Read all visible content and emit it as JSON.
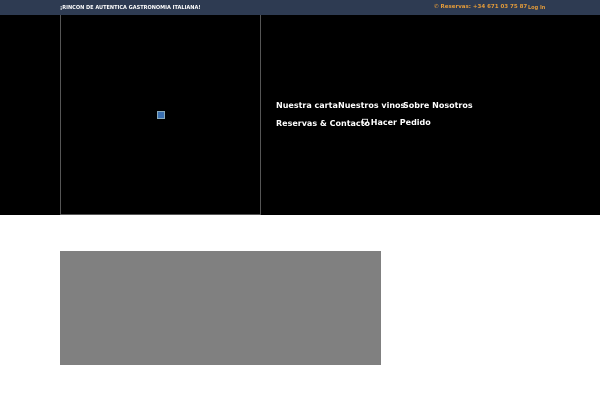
{
  "topbar": {
    "tagline": "¡RINCON DE AUTENTICA GASTRONOMIA ITALIANA!",
    "phone": "Reservas: +34 671 03 75 87",
    "login": "Log In"
  },
  "nav": {
    "items": [
      "Nuestra carta",
      "Nuestros vinos",
      "Sobre Nosotros",
      "Reservas & Contacto",
      "Hacer Pedido"
    ]
  }
}
